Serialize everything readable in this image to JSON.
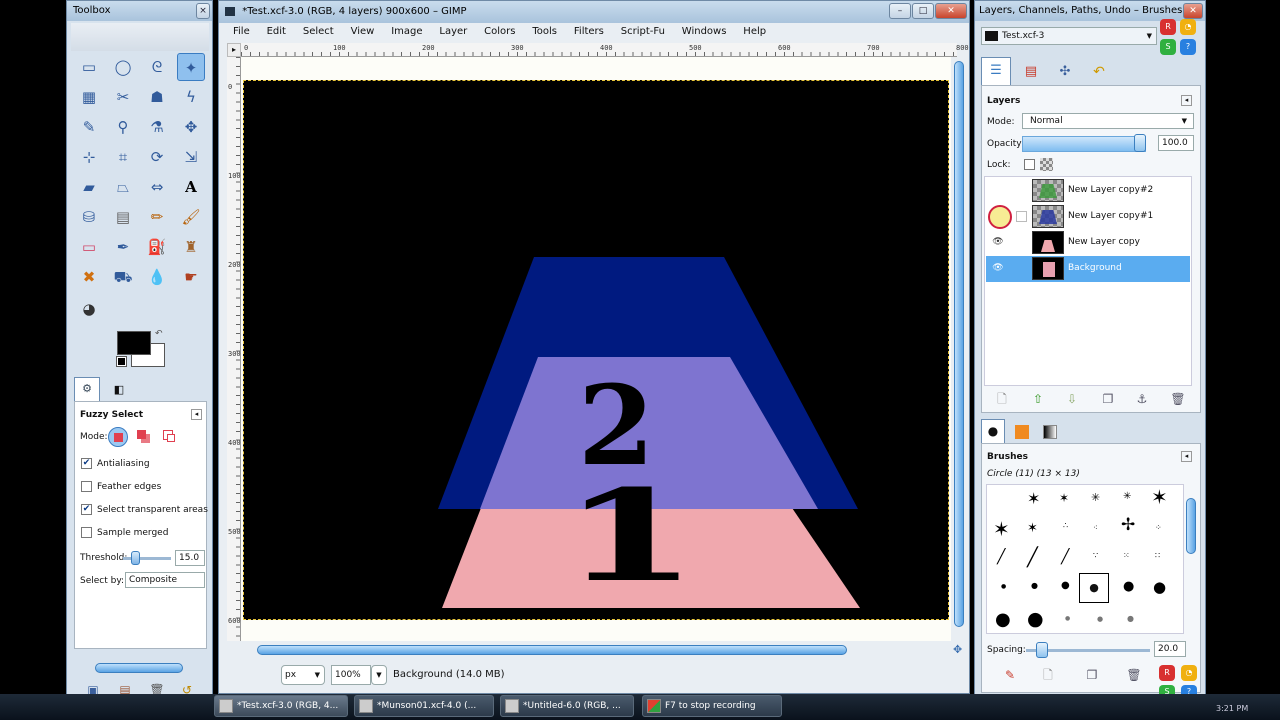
{
  "toolbox": {
    "title": "Toolbox",
    "tool_options": {
      "title": "Fuzzy Select",
      "mode_label": "Mode:",
      "antialiasing": "Antialiasing",
      "feather_edges": "Feather edges",
      "select_transparent": "Select transparent areas",
      "sample_merged": "Sample merged",
      "threshold_label": "Threshold:",
      "threshold_value": "15.0",
      "select_by_label": "Select by:",
      "select_by_value": "Composite"
    }
  },
  "image_window": {
    "title": "*Test.xcf-3.0 (RGB, 4 layers) 900x600 – GIMP",
    "menu": [
      "File",
      "Edit",
      "Select",
      "View",
      "Image",
      "Layer",
      "Colors",
      "Tools",
      "Filters",
      "Script-Fu",
      "Windows",
      "Help"
    ],
    "ruler_h": [
      "0",
      "100",
      "200",
      "300",
      "400",
      "500",
      "600",
      "700",
      "800"
    ],
    "ruler_v": [
      "0",
      "100",
      "200",
      "300",
      "400",
      "500",
      "600"
    ],
    "canvas": {
      "number_top": "2",
      "number_bottom": "1"
    },
    "status": {
      "unit": "px",
      "zoom": "100%",
      "message": "Background (14.0 MB)"
    }
  },
  "dock": {
    "title": "Layers, Channels, Paths, Undo – Brushes, P...",
    "image_select": "Test.xcf-3",
    "layers": {
      "title": "Layers",
      "mode_label": "Mode:",
      "mode_value": "Normal",
      "opacity_label": "Opacity:",
      "opacity_value": "100.0",
      "lock_label": "Lock:",
      "rows": [
        {
          "name": "New Layer copy#2",
          "visible": false,
          "selected": false
        },
        {
          "name": "New Layer copy#1",
          "visible": false,
          "selected": false
        },
        {
          "name": "New Layer copy",
          "visible": true,
          "selected": false
        },
        {
          "name": "Background",
          "visible": true,
          "selected": true
        }
      ]
    },
    "brushes": {
      "title": "Brushes",
      "current": "Circle (11) (13 × 13)",
      "spacing_label": "Spacing:",
      "spacing_value": "20.0"
    }
  },
  "taskbar": {
    "items": [
      "*Test.xcf-3.0 (RGB, 4...",
      "*Munson01.xcf-4.0 (...",
      "*Untitled-6.0 (RGB, ...",
      "F7 to stop recording"
    ],
    "clock": "3:21 PM"
  },
  "colors": {
    "accent": "#3a8fd8",
    "selection": "#6aaff0",
    "canvas_bg": "#000000",
    "shape_blue": "#001a80",
    "shape_lavender": "#7e74d0",
    "shape_pink": "#f0a8ae"
  }
}
